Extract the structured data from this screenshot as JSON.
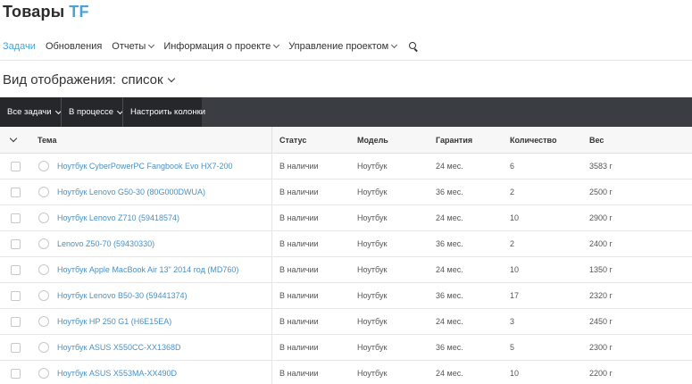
{
  "header": {
    "title": "Товары",
    "title_accent": "TF"
  },
  "nav": {
    "items": [
      {
        "label": "Задачи",
        "active": true,
        "dropdown": false
      },
      {
        "label": "Обновления",
        "active": false,
        "dropdown": false
      },
      {
        "label": "Отчеты",
        "active": false,
        "dropdown": true
      },
      {
        "label": "Информация о проекте",
        "active": false,
        "dropdown": true
      },
      {
        "label": "Управление проектом",
        "active": false,
        "dropdown": true
      }
    ],
    "search_icon": "search-icon"
  },
  "view_mode": {
    "label": "Вид отображения:",
    "value": "список"
  },
  "toolbar": {
    "all_tasks": "Все задачи",
    "in_progress": "В процессе",
    "configure_columns": "Настроить колонки"
  },
  "table": {
    "columns": [
      "Тема",
      "Статус",
      "Модель",
      "Гарантия",
      "Количество",
      "Вес"
    ],
    "rows": [
      {
        "topic": "Ноутбук CyberPowerPC Fangbook Evo HX7-200",
        "status": "В наличии",
        "model": "Ноутбук",
        "warranty": "24 мес.",
        "qty": "6",
        "weight": "3583 г"
      },
      {
        "topic": "Ноутбук Lenovo G50-30 (80G000DWUA)",
        "status": "В наличии",
        "model": "Ноутбук",
        "warranty": "36 мес.",
        "qty": "2",
        "weight": "2500 г"
      },
      {
        "topic": "Ноутбук Lenovo Z710 (59418574)",
        "status": "В наличии",
        "model": "Ноутбук",
        "warranty": "24 мес.",
        "qty": "10",
        "weight": "2900 г"
      },
      {
        "topic": "Lenovo Z50-70 (59430330)",
        "status": "В наличии",
        "model": "Ноутбук",
        "warranty": "36 мес.",
        "qty": "2",
        "weight": "2400 г"
      },
      {
        "topic": "Ноутбук Apple MacBook Air 13\" 2014 год (MD760)",
        "status": "В наличии",
        "model": "Ноутбук",
        "warranty": "24 мес.",
        "qty": "10",
        "weight": "1350 г"
      },
      {
        "topic": "Ноутбук Lenovo B50-30 (59441374)",
        "status": "В наличии",
        "model": "Ноутбук",
        "warranty": "36 мес.",
        "qty": "17",
        "weight": "2320 г"
      },
      {
        "topic": "Ноутбук HP 250 G1 (H6E15EA)",
        "status": "В наличии",
        "model": "Ноутбук",
        "warranty": "24 мес.",
        "qty": "3",
        "weight": "2450 г"
      },
      {
        "topic": "Ноутбук ASUS X550CC-XX1368D",
        "status": "В наличии",
        "model": "Ноутбук",
        "warranty": "36 мес.",
        "qty": "5",
        "weight": "2300 г"
      },
      {
        "topic": "Ноутбук ASUS X553MA-XX490D",
        "status": "В наличии",
        "model": "Ноутбук",
        "warranty": "24 мес.",
        "qty": "10",
        "weight": "2200 г"
      }
    ]
  },
  "colors": {
    "accent": "#4ba3d4",
    "link": "#4a90c4",
    "toolbar_bg": "#3a3d41",
    "toolbar_btn_bg": "#25272a"
  }
}
